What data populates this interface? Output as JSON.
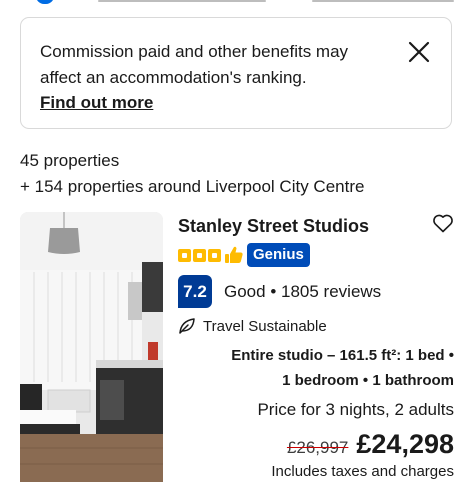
{
  "banner": {
    "message": "Commission paid and other benefits may affect an accommodation's ranking.",
    "link_label": "Find out more",
    "close_icon": "close-icon"
  },
  "results": {
    "count_label": "45 properties",
    "nearby_label": "+ 154 properties around Liverpool City Centre"
  },
  "property": {
    "name": "Stanley Street Studios",
    "stars": 3,
    "genius_label": "Genius",
    "score": "7.2",
    "score_word": "Good",
    "reviews_label": "1805 reviews",
    "sustainable_label": "Travel Sustainable",
    "room_line1": "Entire studio – 161.5 ft²: 1 bed •",
    "room_line2": "1 bedroom • 1 bathroom",
    "price_for": "Price for 3 nights, 2 adults",
    "old_price": "£26,997",
    "new_price": "£24,298",
    "taxes_label": "Includes taxes and charges"
  },
  "colors": {
    "genius_blue": "#004cb8",
    "score_blue": "#003b95",
    "star_yellow": "#febb02"
  }
}
